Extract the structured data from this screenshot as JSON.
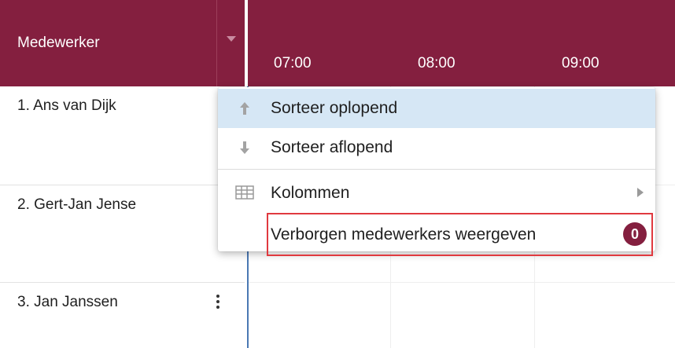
{
  "header": {
    "column_title": "Medewerker",
    "times": [
      "07:00",
      "08:00",
      "09:00"
    ]
  },
  "employees": [
    {
      "name": "1. Ans van Dijk"
    },
    {
      "name": "2. Gert-Jan Jense"
    },
    {
      "name": "3. Jan Janssen"
    }
  ],
  "context_menu": {
    "items": [
      {
        "label": "Sorteer oplopend",
        "icon": "arrow-up-icon",
        "highlighted": true
      },
      {
        "label": "Sorteer aflopend",
        "icon": "arrow-down-icon"
      },
      {
        "label": "Kolommen",
        "icon": "columns-icon",
        "has_submenu": true
      },
      {
        "label": "Verborgen medewerkers weergeven",
        "badge": "0",
        "outlined": true
      }
    ]
  },
  "colors": {
    "header_bg": "#841f3f",
    "menu_highlight": "#d6e7f5",
    "badge_bg": "#841f3f",
    "annotation_outline": "#e0393f",
    "frozen_divider": "#4a78b3"
  }
}
